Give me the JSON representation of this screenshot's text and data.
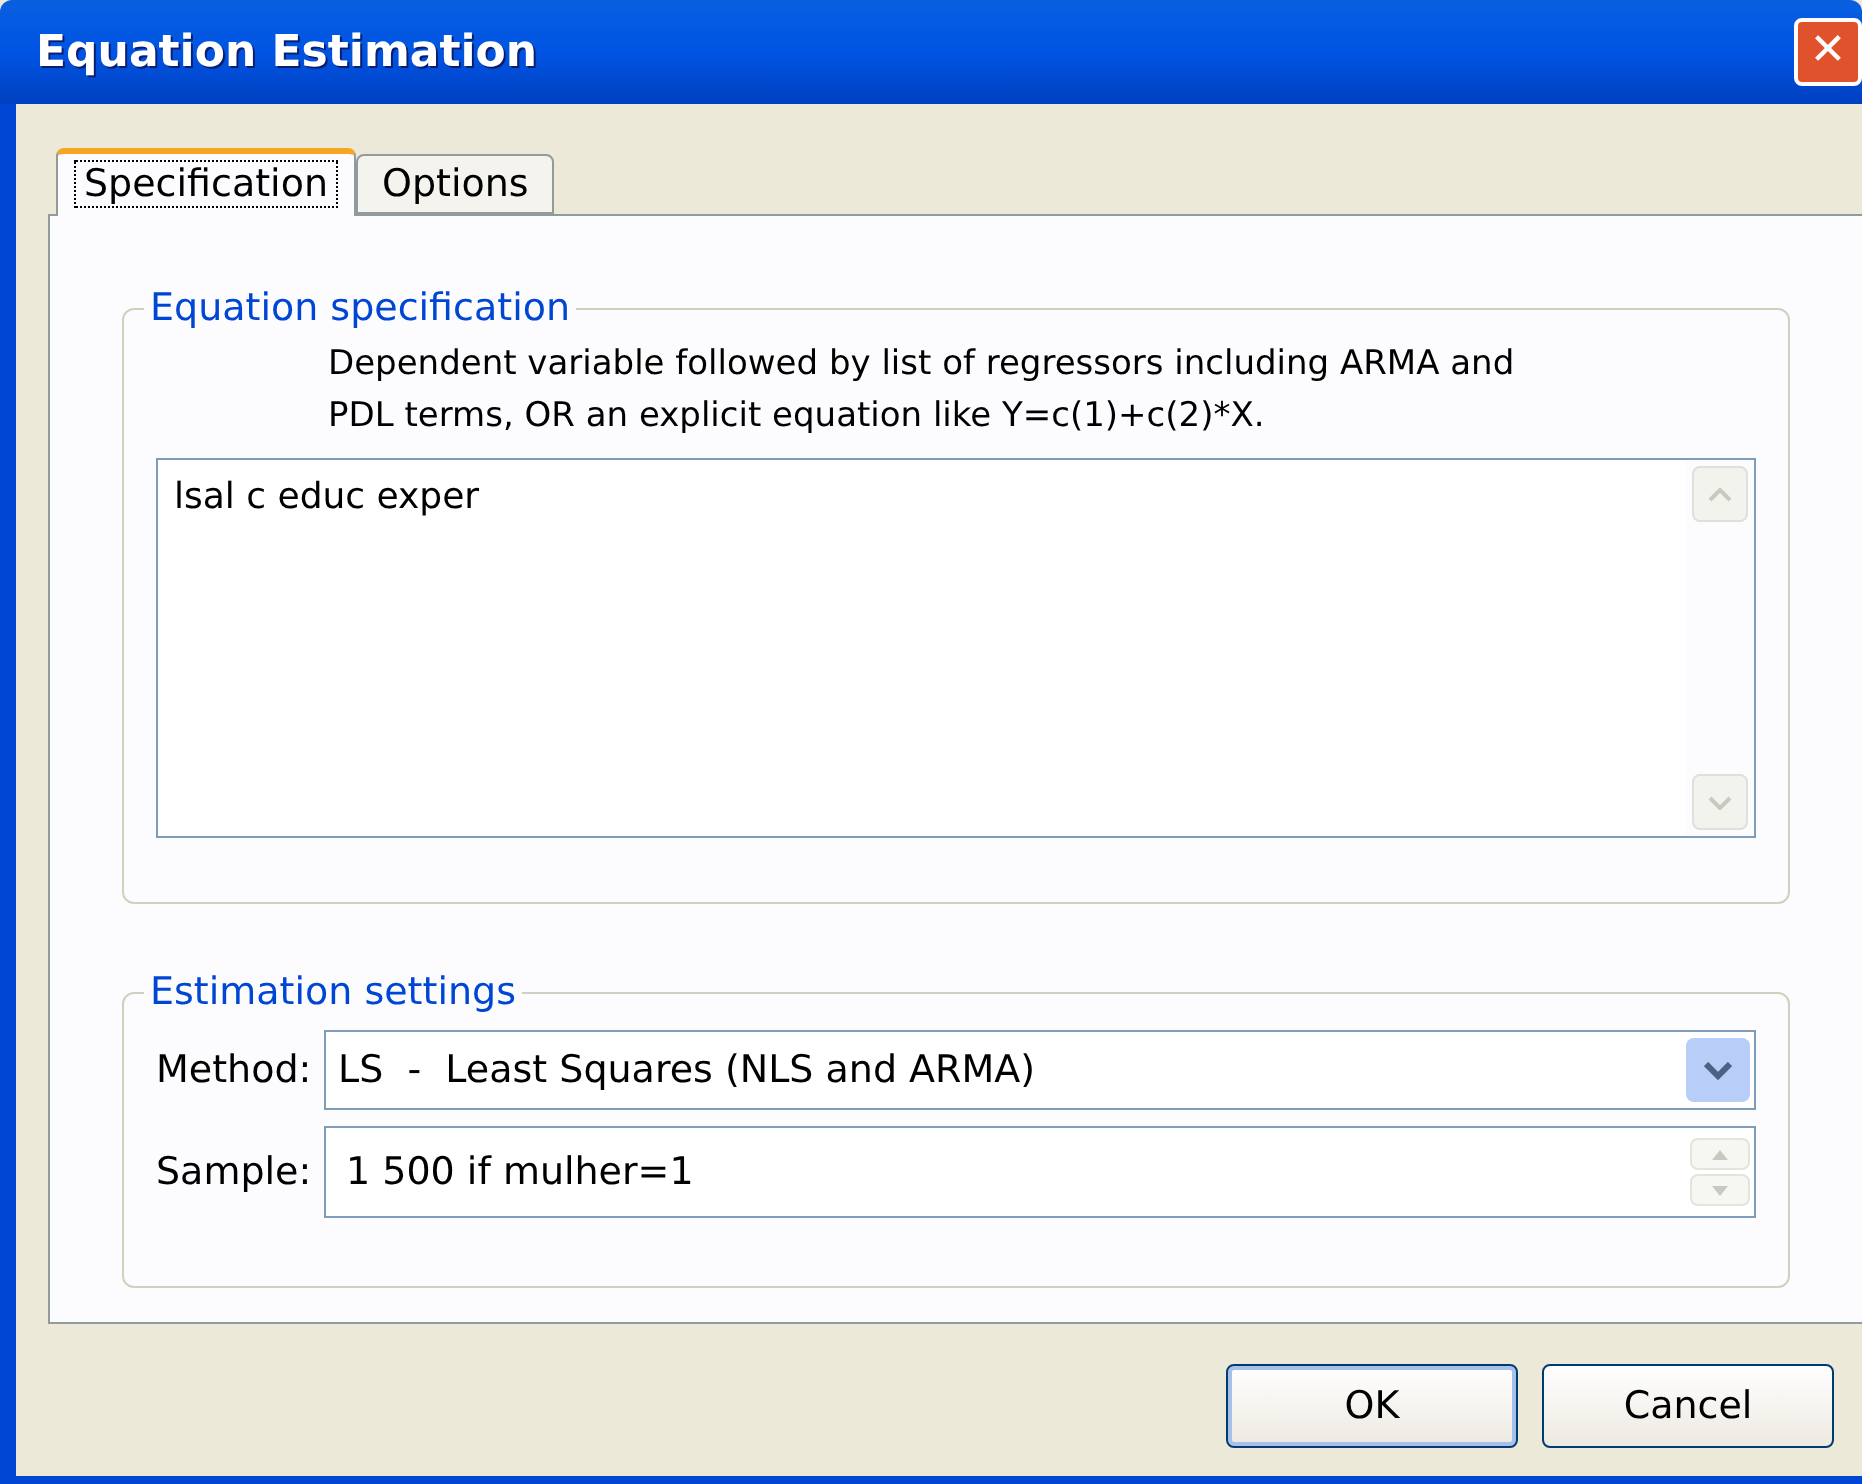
{
  "window": {
    "title": "Equation Estimation",
    "close": "✕"
  },
  "tabs": [
    {
      "label": "Specification",
      "selected": true
    },
    {
      "label": "Options",
      "selected": false
    }
  ],
  "equation_specification": {
    "title": "Equation specification",
    "hint": "Dependent variable followed by list of regressors including ARMA and PDL terms, OR an explicit equation like Y=c(1)+c(2)*X.",
    "value": "lsal c educ exper"
  },
  "estimation_settings": {
    "title": "Estimation settings",
    "method_label": "Method:",
    "method_value": "LS  -  Least Squares (NLS and ARMA)",
    "sample_label": "Sample:",
    "sample_value": "1 500 if mulher=1"
  },
  "buttons": [
    {
      "label": "OK",
      "default": true
    },
    {
      "label": "Cancel",
      "default": false
    }
  ]
}
